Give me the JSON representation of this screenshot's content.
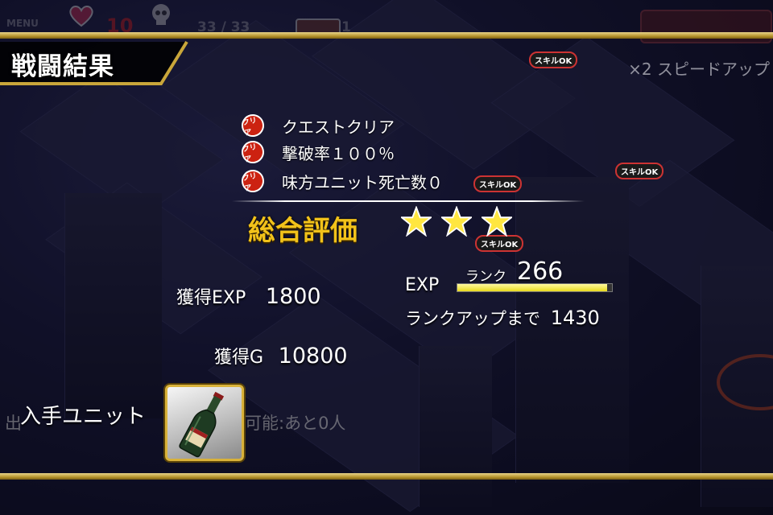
{
  "hud": {
    "menu_label": "MENU",
    "life_value": "10",
    "enemy_count": "33 / 33",
    "treasure_count": "1"
  },
  "header": {
    "title": "戦闘結果"
  },
  "speed_up": {
    "label": "×2 スピードアップ"
  },
  "skill_ok_label": "スキルOK",
  "conditions": {
    "stamp_label": "クリア",
    "items": [
      {
        "label": "クエストクリア"
      },
      {
        "label": "撃破率１００％"
      },
      {
        "label": "味方ユニット死亡数０"
      }
    ]
  },
  "rating": {
    "label": "総合評価",
    "stars": 3
  },
  "results": {
    "exp_label": "獲得EXP",
    "exp_value": "1800",
    "gold_label": "獲得G",
    "gold_value": "10800"
  },
  "rank": {
    "exp_label": "EXP",
    "rank_label": "ランク",
    "rank_value": "266",
    "exp_progress": 0.97,
    "next_label": "ランクアップまで",
    "next_value": "1430"
  },
  "unit": {
    "label": "入手ユニット",
    "background_left": "出",
    "background_right": "可能:あと0人"
  },
  "colors": {
    "gold": "#f2c21a",
    "band": "#c9a63a",
    "stamp_red": "#c21"
  }
}
